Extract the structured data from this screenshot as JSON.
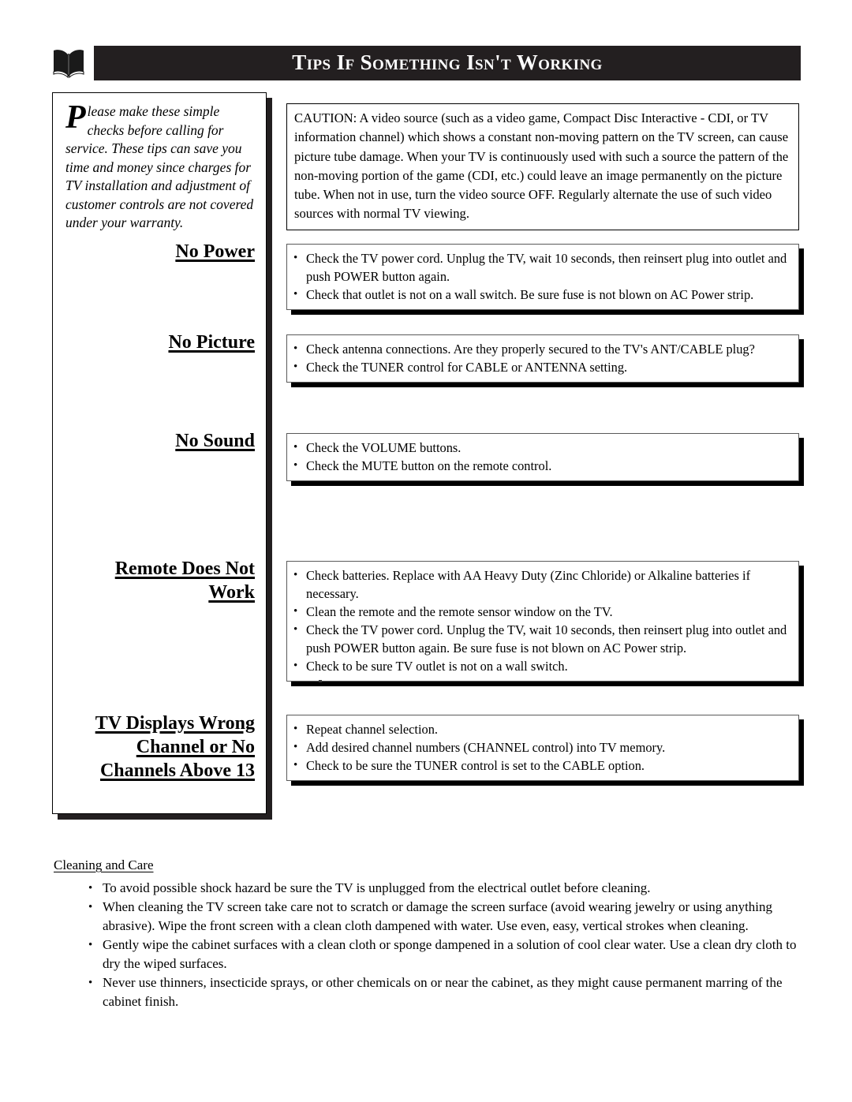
{
  "header": {
    "icon": "open-book-icon",
    "title": "Tips If Something Isn't Working"
  },
  "intro": {
    "dropcap": "P",
    "body": "lease make these simple checks before calling for service. These tips can save you time and money since charges for TV installation and adjustment of customer controls are not covered under your warranty."
  },
  "caution": {
    "text": "CAUTION: A video source (such as a video game, Compact Disc Interactive - CDI, or TV information channel) which shows a constant non-moving pattern on the TV screen, can cause picture tube damage.  When your TV is continuously used with such a source the pattern of the non-moving portion of the game (CDI, etc.) could leave an image permanently on the picture tube.  When not in use, turn the video source OFF. Regularly alternate the use of such video sources with normal TV viewing."
  },
  "sections": [
    {
      "heading_lines": [
        "No Power"
      ],
      "tips": [
        "Check the TV power cord.  Unplug the TV, wait 10 seconds, then reinsert plug into outlet and push POWER button again.",
        "Check that outlet is not on a wall switch. Be sure fuse is not blown on AC Power strip."
      ]
    },
    {
      "heading_lines": [
        "No Picture"
      ],
      "tips": [
        "Check antenna connections.  Are they properly secured to the TV's ANT/CABLE plug?",
        "Check the TUNER control for CABLE or ANTENNA setting."
      ]
    },
    {
      "heading_lines": [
        "No Sound"
      ],
      "tips": [
        "Check the VOLUME buttons.",
        "Check the MUTE button on the remote control."
      ]
    },
    {
      "heading_lines": [
        "Remote Does Not",
        "Work"
      ],
      "tips": [
        "Check batteries.  Replace with AA Heavy Duty (Zinc Chloride) or Alkaline batteries if necessary.",
        "Clean the remote and the remote sensor window on the TV.",
        "Check the TV power cord.  Unplug the TV, wait 10 seconds, then reinsert plug into outlet and push POWER button again. Be sure fuse is not blown on AC Power strip.",
        "Check to be sure TV outlet is not on a wall switch."
      ]
    },
    {
      "heading_lines": [
        "TV Displays Wrong",
        "Channel or No",
        "Channels Above 13"
      ],
      "tips": [
        "Repeat channel selection.",
        "Add desired channel numbers (CHANNEL control) into TV memory.",
        "Check to be sure the TUNER control is set to the CABLE option."
      ]
    }
  ],
  "cleaning": {
    "title": "Cleaning and Care",
    "items": [
      "To avoid possible shock hazard be sure the TV is unplugged from the electrical outlet before cleaning.",
      "When cleaning the TV screen take care not to scratch or damage the screen surface (avoid wearing jewelry or using anything abrasive). Wipe the front screen with a clean cloth dampened with water. Use even, easy, vertical strokes when cleaning.",
      "Gently wipe the cabinet surfaces with a clean cloth or sponge dampened in a solution of cool clear water. Use a clean dry cloth to dry the wiped surfaces.",
      "Never use thinners, insecticide sprays, or other chemicals on or near the cabinet, as they might cause permanent marring of the cabinet finish."
    ]
  },
  "colors": {
    "title_bar_bg": "#231f20",
    "title_text": "#ffffff",
    "body_text": "#000000",
    "shadow": "#000000"
  },
  "layout": {
    "heading_tops": [
      305,
      420,
      545,
      707,
      903
    ],
    "tipbox_tops": [
      309,
      424,
      549,
      711,
      906
    ]
  }
}
